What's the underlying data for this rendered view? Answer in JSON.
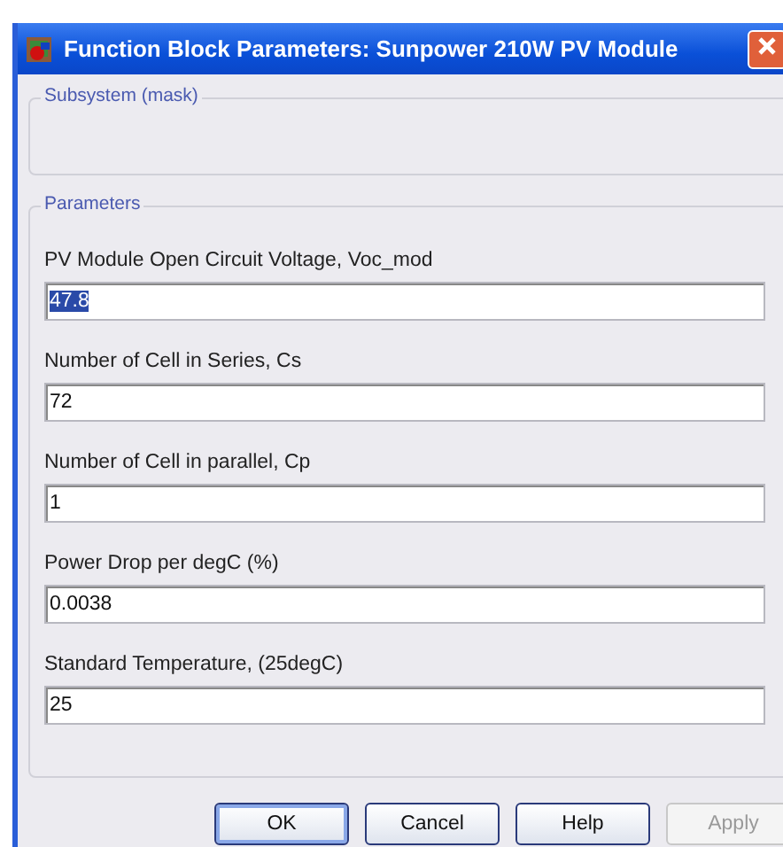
{
  "window": {
    "title": "Function Block Parameters: Sunpower 210W PV Module"
  },
  "groups": [
    {
      "title": "Subsystem (mask)"
    },
    {
      "title": "Parameters"
    }
  ],
  "parameters": [
    {
      "label": "PV Module Open Circuit Voltage, Voc_mod",
      "value": "47.8",
      "text_selected": true
    },
    {
      "label": "Number of Cell in Series, Cs",
      "value": "72",
      "text_selected": false
    },
    {
      "label": "Number of Cell in parallel, Cp",
      "value": "1",
      "text_selected": false
    },
    {
      "label": "Power Drop per degC (%)",
      "value": "0.0038",
      "text_selected": false
    },
    {
      "label": "Standard Temperature, (25degC)",
      "value": "25",
      "text_selected": false
    }
  ],
  "buttons": [
    {
      "label": "OK",
      "default": true,
      "disabled": false
    },
    {
      "label": "Cancel",
      "default": false,
      "disabled": false
    },
    {
      "label": "Help",
      "default": false,
      "disabled": false
    },
    {
      "label": "Apply",
      "default": false,
      "disabled": true
    }
  ]
}
